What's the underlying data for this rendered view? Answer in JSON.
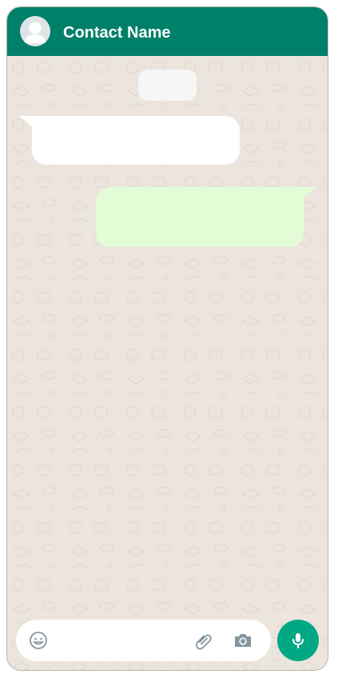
{
  "header": {
    "contact_name": "Contact Name",
    "avatar_icon": "person-icon"
  },
  "chat": {
    "date_chip_text": "",
    "messages": [
      {
        "direction": "incoming",
        "text": ""
      },
      {
        "direction": "outgoing",
        "text": ""
      }
    ]
  },
  "input_bar": {
    "placeholder": "",
    "emoji_icon": "emoji-icon",
    "attach_icon": "paperclip-icon",
    "camera_icon": "camera-icon",
    "mic_icon": "microphone-icon"
  },
  "colors": {
    "header": "#008069",
    "chat_background": "#ece5dd",
    "incoming_bubble": "#ffffff",
    "outgoing_bubble": "#e2fdd6",
    "mic_button": "#00a884"
  }
}
